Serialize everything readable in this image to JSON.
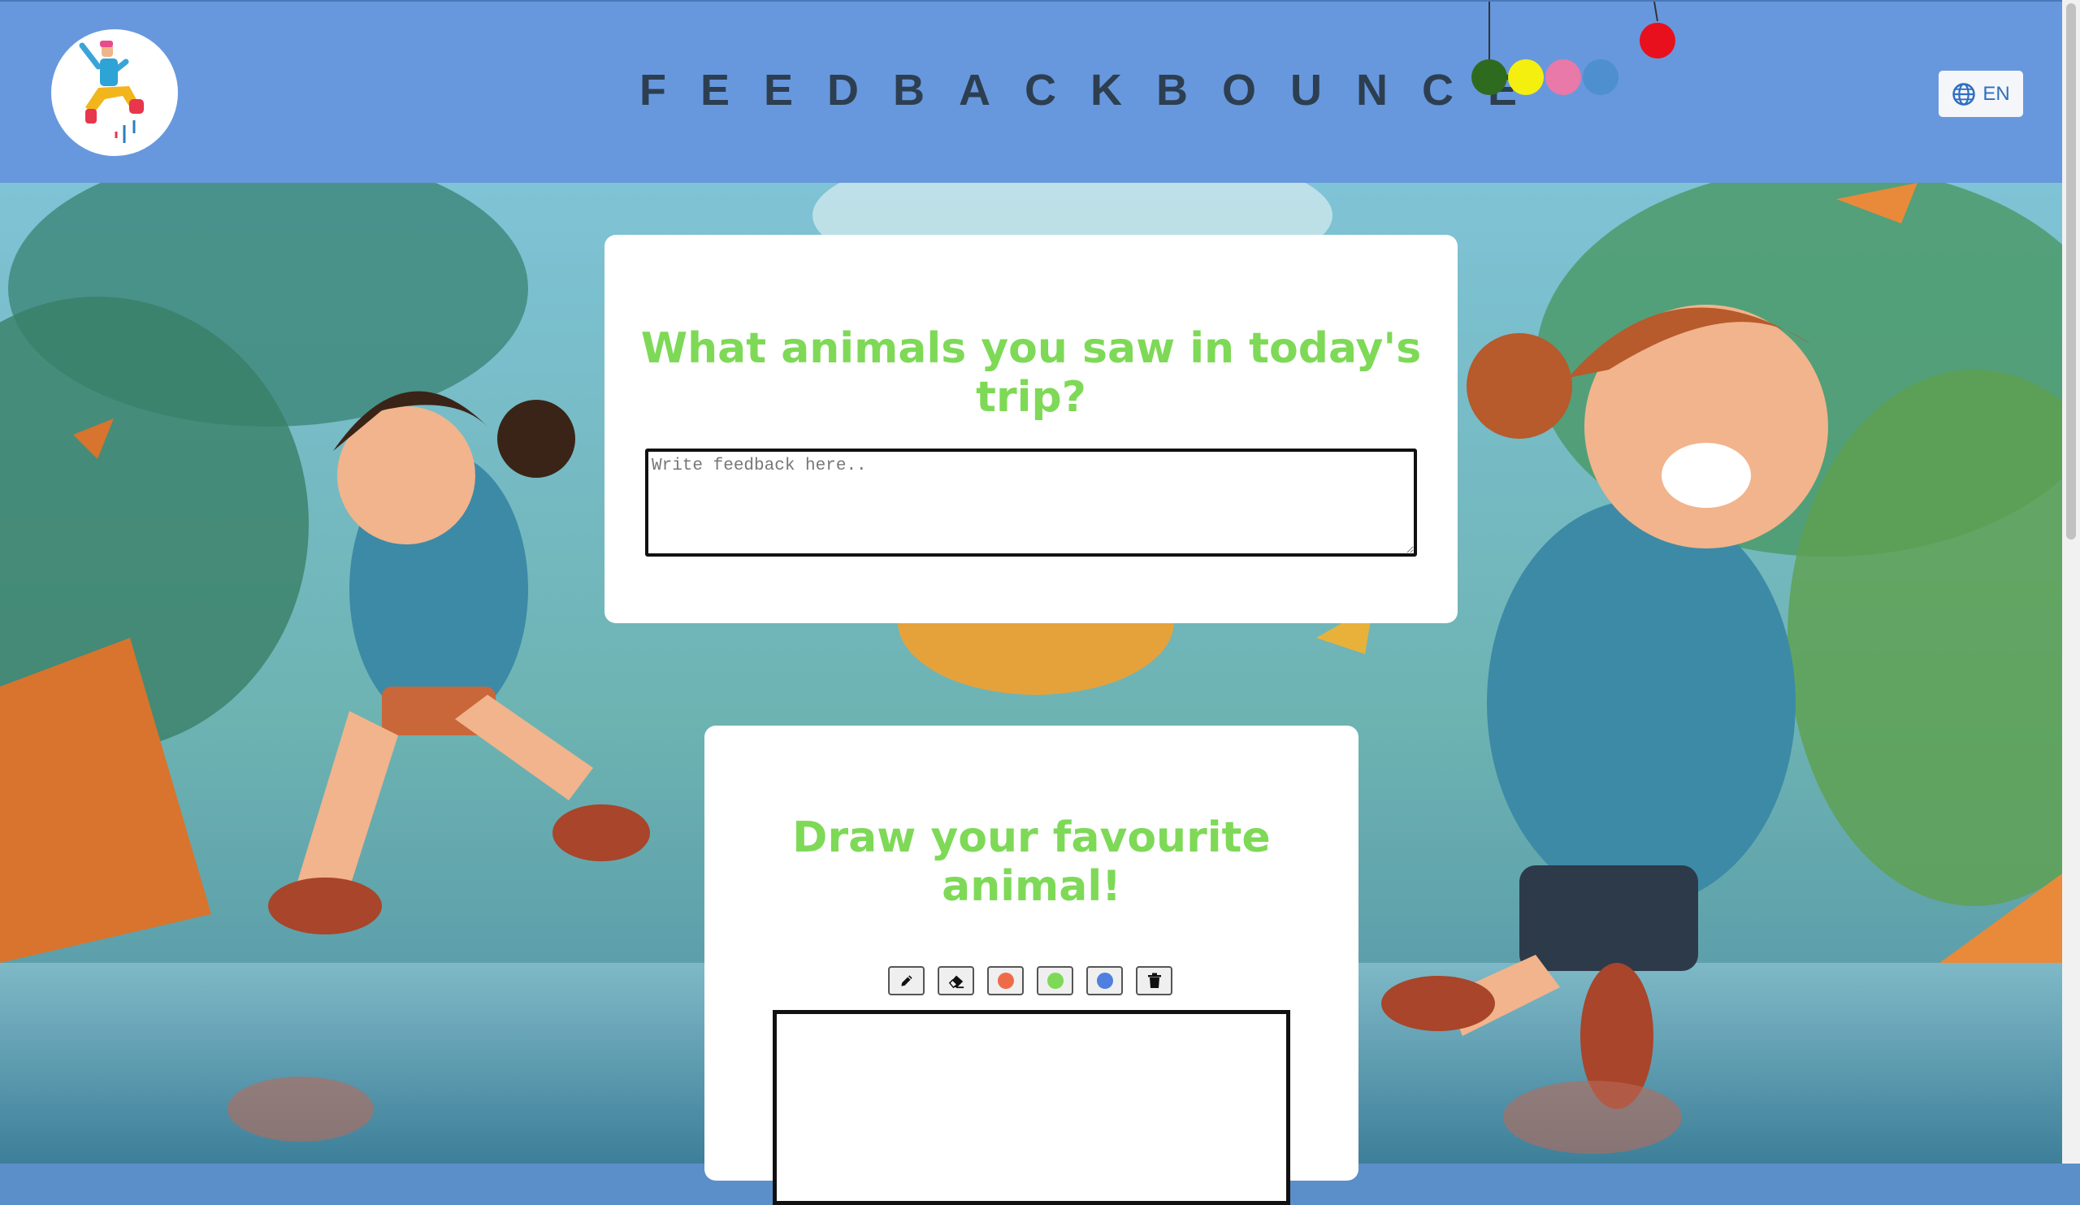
{
  "header": {
    "title": "FEEDBACKBOUNCE",
    "language_label": "EN",
    "balloon_colors": [
      "#2e6b1f",
      "#f5ef0f",
      "#e879a8",
      "#4e8fd0",
      "#e8101c"
    ]
  },
  "question_card": {
    "question": "What animals you saw in today's trip?",
    "placeholder": "Write feedback here.."
  },
  "drawing_card": {
    "question": "Draw your favourite animal!",
    "tools": [
      {
        "name": "pencil-icon"
      },
      {
        "name": "eraser-icon"
      },
      {
        "name": "color-red",
        "color": "#ee6b4a"
      },
      {
        "name": "color-green",
        "color": "#7ed957"
      },
      {
        "name": "color-blue",
        "color": "#4f7fdf"
      },
      {
        "name": "trash-icon"
      }
    ]
  },
  "colors": {
    "header_bg": "#6798dd",
    "question_text": "#7ed957",
    "title_text": "#2c3e50"
  }
}
